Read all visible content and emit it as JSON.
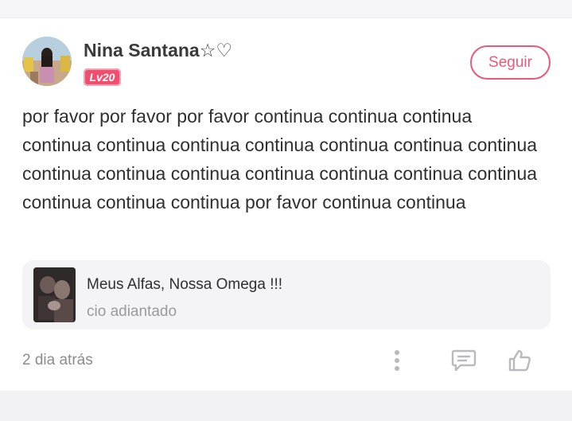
{
  "post": {
    "author": "Nina Santana☆♡",
    "level": "Lv20",
    "follow_label": "Seguir",
    "body": "por favor por favor por favor continua continua continua continua continua continua continua continua continua continua continua continua continua continua continua continua continua continua continua continua por favor continua continua",
    "timestamp": "2 dia atrás"
  },
  "story": {
    "title": "Meus Alfas, Nossa Omega !!!",
    "subtitle": "cio adiantado"
  },
  "icons": {
    "more": "more-vertical-icon",
    "comment": "comment-icon",
    "like": "thumbs-up-icon"
  },
  "colors": {
    "accent": "#e8597a",
    "badge": "#ef4f6f",
    "icon": "#b9b9be"
  }
}
